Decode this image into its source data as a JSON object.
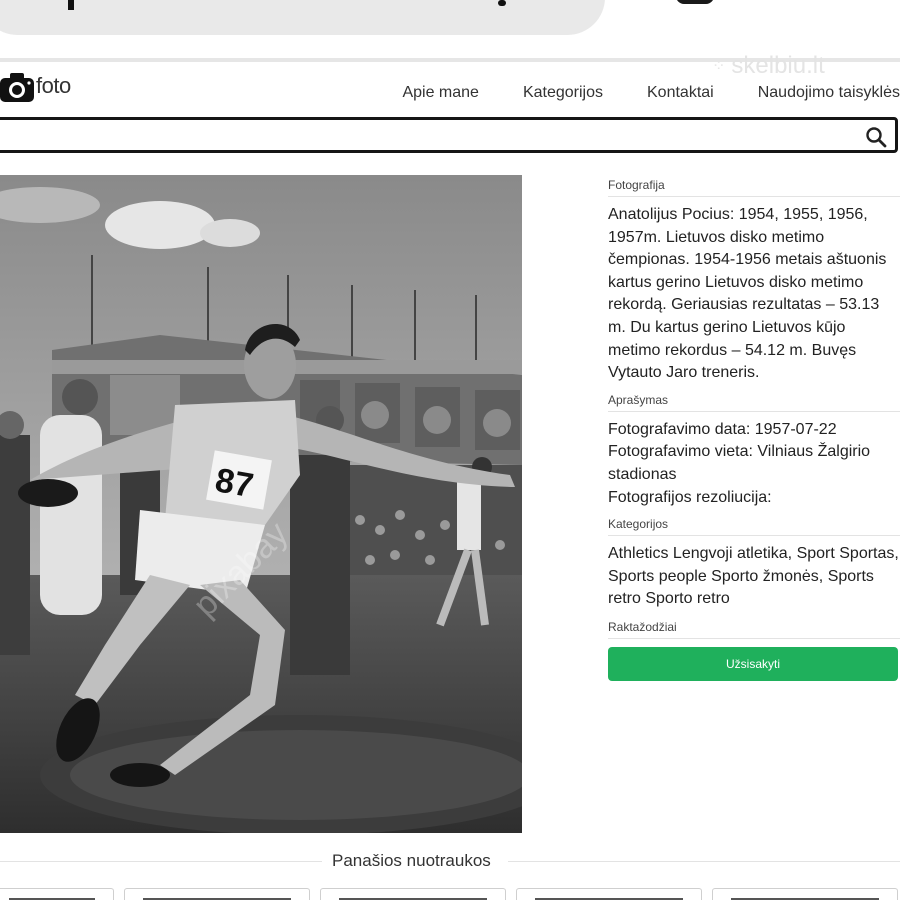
{
  "header": {
    "logo_text": "foto",
    "watermark_text": "skelbiu.lt",
    "nav": [
      "Apie mane",
      "Kategorijos",
      "Kontaktai",
      "Naudojimo taisyklės"
    ]
  },
  "search": {
    "placeholder": ""
  },
  "photo": {
    "bib_number": "87",
    "watermark": "pixabay"
  },
  "info": {
    "photo_title": "Fotografija",
    "photo_text": "Anatolijus Pocius: 1954, 1955, 1956, 1957m. Lietuvos disko metimo čempionas. 1954-1956 metais aštuonis kartus gerino Lietuvos disko metimo rekordą. Geriausias rezultatas – 53.13 m. Du kartus gerino Lietuvos kūjo metimo rekordus – 54.12 m. Buvęs Vytauto Jaro treneris.",
    "desc_title": "Aprašymas",
    "date_line": "Fotografavimo data: 1957-07-22",
    "place_line": "Fotografavimo vieta: Vilniaus Žalgirio stadionas",
    "resolution_line": "Fotografijos rezoliucija:",
    "categories_title": "Kategorijos",
    "categories": [
      "Athletics Lengvoji atletika,",
      "Sport Sportas,",
      "Sports people Sporto žmonės,",
      "Sports retro Sporto retro"
    ],
    "keywords_title": "Raktažodžiai",
    "subscribe_label": "Užsisakyti"
  },
  "similar": {
    "title": "Panašios nuotraukos"
  },
  "colors": {
    "accent": "#1fb05c",
    "search_border": "#151515"
  }
}
